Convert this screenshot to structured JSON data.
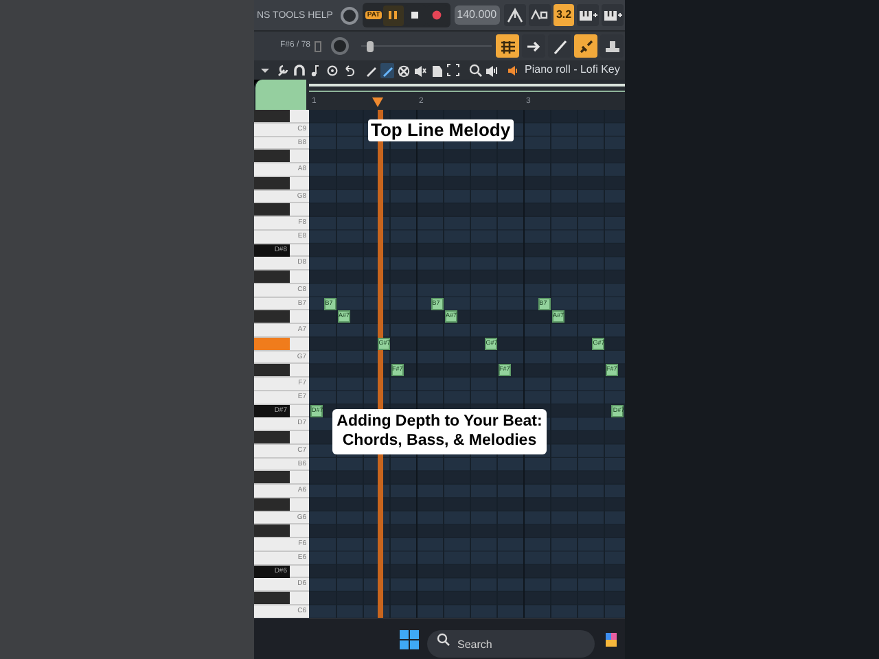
{
  "menu": {
    "text": "NS TOOLS HELP"
  },
  "transport": {
    "mode": "PAT",
    "tempo": "140.000",
    "buttons": [
      {
        "kind": "pause",
        "on": true
      },
      {
        "kind": "stop",
        "on": false
      },
      {
        "kind": "record",
        "on": false
      }
    ]
  },
  "top_tools": [
    {
      "kind": "metronome",
      "on": false
    },
    {
      "kind": "wave",
      "on": false
    },
    {
      "kind": "counter",
      "label": "3.2",
      "on": true
    },
    {
      "kind": "keys",
      "on": false
    },
    {
      "kind": "keys",
      "on": false
    }
  ],
  "position": "F#6 / 78",
  "pitch_slider": {
    "level": 0.05
  },
  "second_tools": [
    {
      "kind": "bars",
      "on": true
    },
    {
      "kind": "arrow",
      "on": false
    },
    {
      "kind": "pen",
      "on": false
    },
    {
      "kind": "link",
      "on": true
    },
    {
      "kind": "stamp",
      "on": false
    }
  ],
  "piano_roll": {
    "title": "Piano roll - Lofi Key",
    "tools": [
      {
        "kind": "caret",
        "selected": false
      },
      {
        "kind": "wrench",
        "selected": false
      },
      {
        "kind": "magnet",
        "selected": false
      },
      {
        "kind": "note",
        "selected": false
      },
      {
        "kind": "circle",
        "selected": false
      },
      {
        "kind": "undo",
        "selected": false
      },
      {
        "kind": "pencil",
        "selected": false
      },
      {
        "kind": "brush",
        "selected": true
      },
      {
        "kind": "delete",
        "selected": false
      },
      {
        "kind": "mute",
        "selected": false
      },
      {
        "kind": "slice",
        "selected": false
      },
      {
        "kind": "select",
        "selected": false
      },
      {
        "kind": "zoom",
        "selected": false
      },
      {
        "kind": "speaker",
        "selected": false
      }
    ],
    "ruler": [
      "1",
      "2",
      "3"
    ],
    "keys": [
      {
        "kind": "black",
        "pressed": false
      },
      {
        "kind": "white",
        "label": "C9",
        "pressed": false
      },
      {
        "kind": "white",
        "label": "B8",
        "pressed": false
      },
      {
        "kind": "black",
        "pressed": false
      },
      {
        "kind": "white",
        "label": "A8",
        "pressed": false
      },
      {
        "kind": "black",
        "pressed": false
      },
      {
        "kind": "white",
        "label": "G8",
        "pressed": false
      },
      {
        "kind": "black",
        "pressed": false
      },
      {
        "kind": "white",
        "label": "F8",
        "pressed": false
      },
      {
        "kind": "white",
        "label": "E8",
        "pressed": false
      },
      {
        "kind": "black",
        "label": "D#8",
        "pressed": false
      },
      {
        "kind": "white",
        "label": "D8",
        "pressed": false
      },
      {
        "kind": "black",
        "pressed": false
      },
      {
        "kind": "white",
        "label": "C8",
        "pressed": false
      },
      {
        "kind": "white",
        "label": "B7",
        "pressed": false,
        "notes": [
          {
            "label": "B7"
          },
          {
            "label": "B7"
          },
          {
            "label": "B7"
          }
        ]
      },
      {
        "kind": "black",
        "pressed": false,
        "notes": [
          {
            "label": "A#7"
          },
          {
            "label": "A#7"
          },
          {
            "label": "A#7"
          }
        ]
      },
      {
        "kind": "white",
        "label": "A7",
        "pressed": false
      },
      {
        "kind": "black",
        "pressed": true,
        "notes": [
          {
            "label": "G#7"
          },
          {
            "label": "G#7"
          },
          {
            "label": "G#7"
          }
        ]
      },
      {
        "kind": "white",
        "label": "G7",
        "pressed": false
      },
      {
        "kind": "black",
        "pressed": false,
        "notes": [
          {
            "label": "F#7"
          },
          {
            "label": "F#7"
          },
          {
            "label": "F#7"
          }
        ]
      },
      {
        "kind": "white",
        "label": "F7",
        "pressed": false
      },
      {
        "kind": "white",
        "label": "E7",
        "pressed": false
      },
      {
        "kind": "black",
        "label": "D#7",
        "pressed": false,
        "notes": [
          {
            "label": "D#7"
          },
          {
            "label": "D#7"
          }
        ]
      },
      {
        "kind": "white",
        "label": "D7",
        "pressed": false
      },
      {
        "kind": "black",
        "pressed": false
      },
      {
        "kind": "white",
        "label": "C7",
        "pressed": false
      },
      {
        "kind": "white",
        "label": "B6",
        "pressed": false
      },
      {
        "kind": "black",
        "pressed": false
      },
      {
        "kind": "white",
        "label": "A6",
        "pressed": false
      },
      {
        "kind": "black",
        "pressed": false
      },
      {
        "kind": "white",
        "label": "G6",
        "pressed": false
      },
      {
        "kind": "black",
        "pressed": false
      },
      {
        "kind": "white",
        "label": "F6",
        "pressed": false
      },
      {
        "kind": "white",
        "label": "E6",
        "pressed": false
      },
      {
        "kind": "black",
        "label": "D#6",
        "pressed": false
      },
      {
        "kind": "white",
        "label": "D6",
        "pressed": false
      },
      {
        "kind": "black",
        "pressed": false
      },
      {
        "kind": "white",
        "label": "C6",
        "pressed": false
      }
    ]
  },
  "captions": [
    {
      "text": "Top Line Melody"
    },
    {
      "text": "Adding Depth to Your Beat: Chords, Bass, & Melodies"
    }
  ],
  "taskbar": {
    "search": {
      "placeholder": "Search"
    }
  }
}
